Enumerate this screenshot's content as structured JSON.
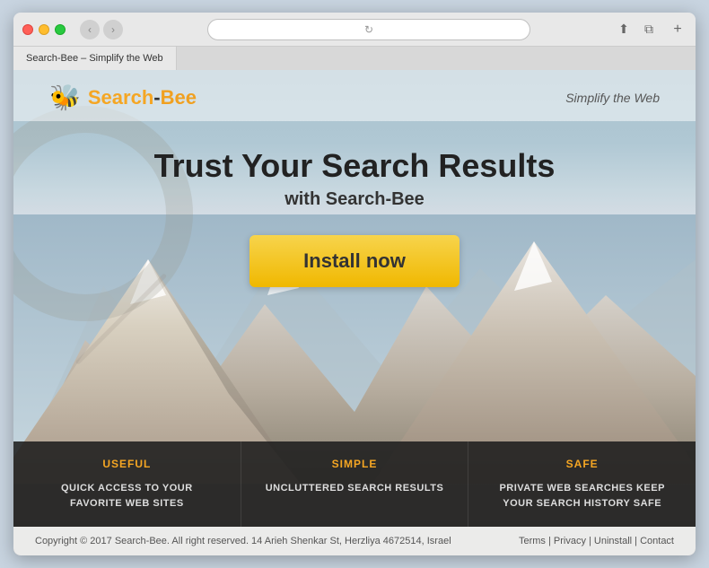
{
  "browser": {
    "traffic_lights": [
      "close",
      "minimize",
      "maximize"
    ],
    "nav_back": "‹",
    "nav_forward": "›",
    "address": "",
    "tab_label": "Search-Bee – Simplify the Web",
    "reload_icon": "↻",
    "share_icon": "⬆",
    "add_tab_icon": "+"
  },
  "site": {
    "header": {
      "logo_icon": "🐝",
      "logo_text_pre": "Search",
      "logo_text_sep": "-",
      "logo_text_post": "Bee",
      "tagline": "Simplify the Web"
    },
    "hero": {
      "title": "Trust Your Search Results",
      "subtitle": "with Search-Bee",
      "install_button": "Install now"
    },
    "features": [
      {
        "label": "USEFUL",
        "desc": "QUICK ACCESS TO YOUR FAVORITE WEB SITES"
      },
      {
        "label": "SIMPLE",
        "desc": "UNCLUTTERED SEARCH RESULTS"
      },
      {
        "label": "SAFE",
        "desc": "PRIVATE WEB SEARCHES KEEP YOUR SEARCH HISTORY SAFE"
      }
    ],
    "footer": {
      "copyright": "Copyright © 2017 Search-Bee. All right reserved. 14 Arieh Shenkar St, Herzliya 4672514, Israel",
      "links": "Terms | Privacy | Uninstall | Contact"
    }
  }
}
